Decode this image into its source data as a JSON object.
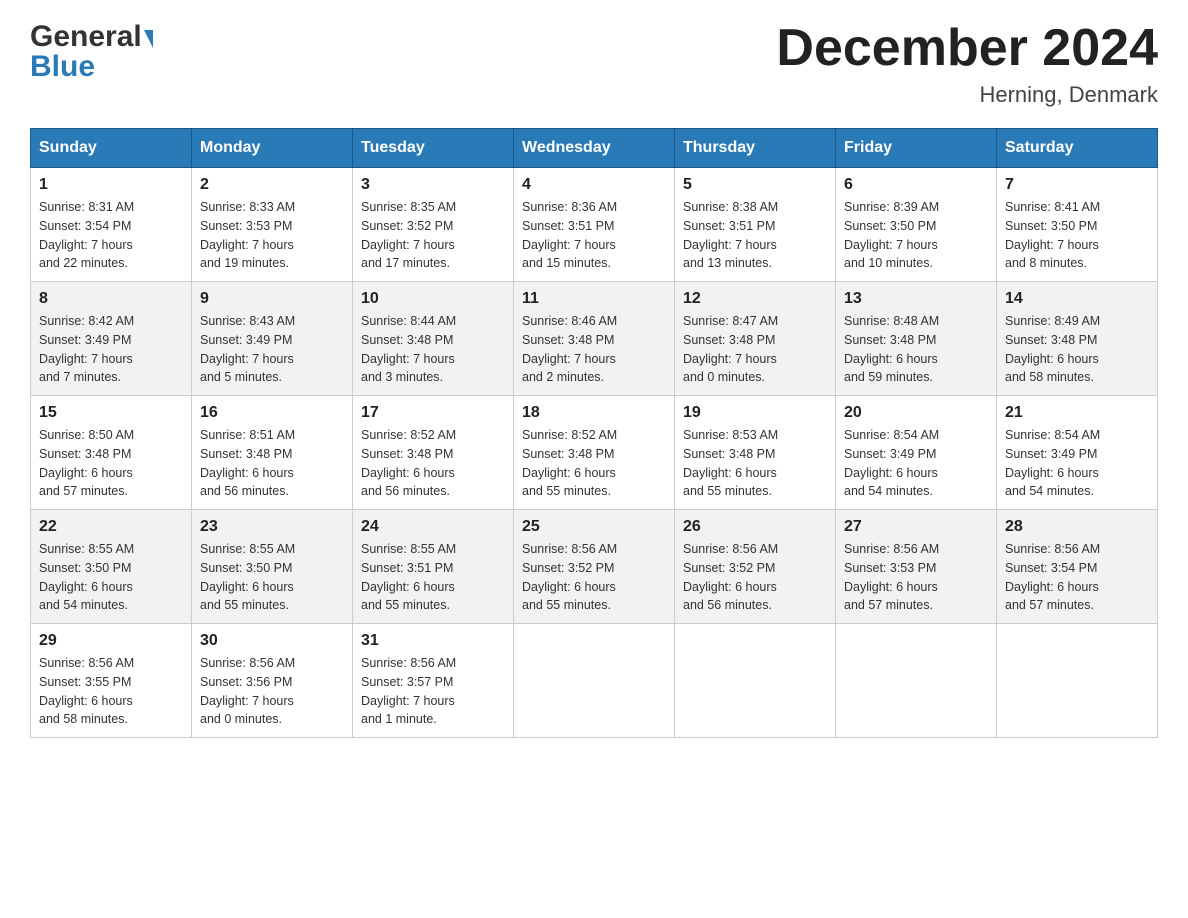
{
  "header": {
    "logo_general": "General",
    "logo_blue": "Blue",
    "title": "December 2024",
    "subtitle": "Herning, Denmark"
  },
  "calendar": {
    "days_of_week": [
      "Sunday",
      "Monday",
      "Tuesday",
      "Wednesday",
      "Thursday",
      "Friday",
      "Saturday"
    ],
    "weeks": [
      [
        {
          "day": "1",
          "sunrise": "Sunrise: 8:31 AM",
          "sunset": "Sunset: 3:54 PM",
          "daylight": "Daylight: 7 hours",
          "daylight2": "and 22 minutes."
        },
        {
          "day": "2",
          "sunrise": "Sunrise: 8:33 AM",
          "sunset": "Sunset: 3:53 PM",
          "daylight": "Daylight: 7 hours",
          "daylight2": "and 19 minutes."
        },
        {
          "day": "3",
          "sunrise": "Sunrise: 8:35 AM",
          "sunset": "Sunset: 3:52 PM",
          "daylight": "Daylight: 7 hours",
          "daylight2": "and 17 minutes."
        },
        {
          "day": "4",
          "sunrise": "Sunrise: 8:36 AM",
          "sunset": "Sunset: 3:51 PM",
          "daylight": "Daylight: 7 hours",
          "daylight2": "and 15 minutes."
        },
        {
          "day": "5",
          "sunrise": "Sunrise: 8:38 AM",
          "sunset": "Sunset: 3:51 PM",
          "daylight": "Daylight: 7 hours",
          "daylight2": "and 13 minutes."
        },
        {
          "day": "6",
          "sunrise": "Sunrise: 8:39 AM",
          "sunset": "Sunset: 3:50 PM",
          "daylight": "Daylight: 7 hours",
          "daylight2": "and 10 minutes."
        },
        {
          "day": "7",
          "sunrise": "Sunrise: 8:41 AM",
          "sunset": "Sunset: 3:50 PM",
          "daylight": "Daylight: 7 hours",
          "daylight2": "and 8 minutes."
        }
      ],
      [
        {
          "day": "8",
          "sunrise": "Sunrise: 8:42 AM",
          "sunset": "Sunset: 3:49 PM",
          "daylight": "Daylight: 7 hours",
          "daylight2": "and 7 minutes."
        },
        {
          "day": "9",
          "sunrise": "Sunrise: 8:43 AM",
          "sunset": "Sunset: 3:49 PM",
          "daylight": "Daylight: 7 hours",
          "daylight2": "and 5 minutes."
        },
        {
          "day": "10",
          "sunrise": "Sunrise: 8:44 AM",
          "sunset": "Sunset: 3:48 PM",
          "daylight": "Daylight: 7 hours",
          "daylight2": "and 3 minutes."
        },
        {
          "day": "11",
          "sunrise": "Sunrise: 8:46 AM",
          "sunset": "Sunset: 3:48 PM",
          "daylight": "Daylight: 7 hours",
          "daylight2": "and 2 minutes."
        },
        {
          "day": "12",
          "sunrise": "Sunrise: 8:47 AM",
          "sunset": "Sunset: 3:48 PM",
          "daylight": "Daylight: 7 hours",
          "daylight2": "and 0 minutes."
        },
        {
          "day": "13",
          "sunrise": "Sunrise: 8:48 AM",
          "sunset": "Sunset: 3:48 PM",
          "daylight": "Daylight: 6 hours",
          "daylight2": "and 59 minutes."
        },
        {
          "day": "14",
          "sunrise": "Sunrise: 8:49 AM",
          "sunset": "Sunset: 3:48 PM",
          "daylight": "Daylight: 6 hours",
          "daylight2": "and 58 minutes."
        }
      ],
      [
        {
          "day": "15",
          "sunrise": "Sunrise: 8:50 AM",
          "sunset": "Sunset: 3:48 PM",
          "daylight": "Daylight: 6 hours",
          "daylight2": "and 57 minutes."
        },
        {
          "day": "16",
          "sunrise": "Sunrise: 8:51 AM",
          "sunset": "Sunset: 3:48 PM",
          "daylight": "Daylight: 6 hours",
          "daylight2": "and 56 minutes."
        },
        {
          "day": "17",
          "sunrise": "Sunrise: 8:52 AM",
          "sunset": "Sunset: 3:48 PM",
          "daylight": "Daylight: 6 hours",
          "daylight2": "and 56 minutes."
        },
        {
          "day": "18",
          "sunrise": "Sunrise: 8:52 AM",
          "sunset": "Sunset: 3:48 PM",
          "daylight": "Daylight: 6 hours",
          "daylight2": "and 55 minutes."
        },
        {
          "day": "19",
          "sunrise": "Sunrise: 8:53 AM",
          "sunset": "Sunset: 3:48 PM",
          "daylight": "Daylight: 6 hours",
          "daylight2": "and 55 minutes."
        },
        {
          "day": "20",
          "sunrise": "Sunrise: 8:54 AM",
          "sunset": "Sunset: 3:49 PM",
          "daylight": "Daylight: 6 hours",
          "daylight2": "and 54 minutes."
        },
        {
          "day": "21",
          "sunrise": "Sunrise: 8:54 AM",
          "sunset": "Sunset: 3:49 PM",
          "daylight": "Daylight: 6 hours",
          "daylight2": "and 54 minutes."
        }
      ],
      [
        {
          "day": "22",
          "sunrise": "Sunrise: 8:55 AM",
          "sunset": "Sunset: 3:50 PM",
          "daylight": "Daylight: 6 hours",
          "daylight2": "and 54 minutes."
        },
        {
          "day": "23",
          "sunrise": "Sunrise: 8:55 AM",
          "sunset": "Sunset: 3:50 PM",
          "daylight": "Daylight: 6 hours",
          "daylight2": "and 55 minutes."
        },
        {
          "day": "24",
          "sunrise": "Sunrise: 8:55 AM",
          "sunset": "Sunset: 3:51 PM",
          "daylight": "Daylight: 6 hours",
          "daylight2": "and 55 minutes."
        },
        {
          "day": "25",
          "sunrise": "Sunrise: 8:56 AM",
          "sunset": "Sunset: 3:52 PM",
          "daylight": "Daylight: 6 hours",
          "daylight2": "and 55 minutes."
        },
        {
          "day": "26",
          "sunrise": "Sunrise: 8:56 AM",
          "sunset": "Sunset: 3:52 PM",
          "daylight": "Daylight: 6 hours",
          "daylight2": "and 56 minutes."
        },
        {
          "day": "27",
          "sunrise": "Sunrise: 8:56 AM",
          "sunset": "Sunset: 3:53 PM",
          "daylight": "Daylight: 6 hours",
          "daylight2": "and 57 minutes."
        },
        {
          "day": "28",
          "sunrise": "Sunrise: 8:56 AM",
          "sunset": "Sunset: 3:54 PM",
          "daylight": "Daylight: 6 hours",
          "daylight2": "and 57 minutes."
        }
      ],
      [
        {
          "day": "29",
          "sunrise": "Sunrise: 8:56 AM",
          "sunset": "Sunset: 3:55 PM",
          "daylight": "Daylight: 6 hours",
          "daylight2": "and 58 minutes."
        },
        {
          "day": "30",
          "sunrise": "Sunrise: 8:56 AM",
          "sunset": "Sunset: 3:56 PM",
          "daylight": "Daylight: 7 hours",
          "daylight2": "and 0 minutes."
        },
        {
          "day": "31",
          "sunrise": "Sunrise: 8:56 AM",
          "sunset": "Sunset: 3:57 PM",
          "daylight": "Daylight: 7 hours",
          "daylight2": "and 1 minute."
        },
        {
          "day": "",
          "sunrise": "",
          "sunset": "",
          "daylight": "",
          "daylight2": ""
        },
        {
          "day": "",
          "sunrise": "",
          "sunset": "",
          "daylight": "",
          "daylight2": ""
        },
        {
          "day": "",
          "sunrise": "",
          "sunset": "",
          "daylight": "",
          "daylight2": ""
        },
        {
          "day": "",
          "sunrise": "",
          "sunset": "",
          "daylight": "",
          "daylight2": ""
        }
      ]
    ]
  }
}
